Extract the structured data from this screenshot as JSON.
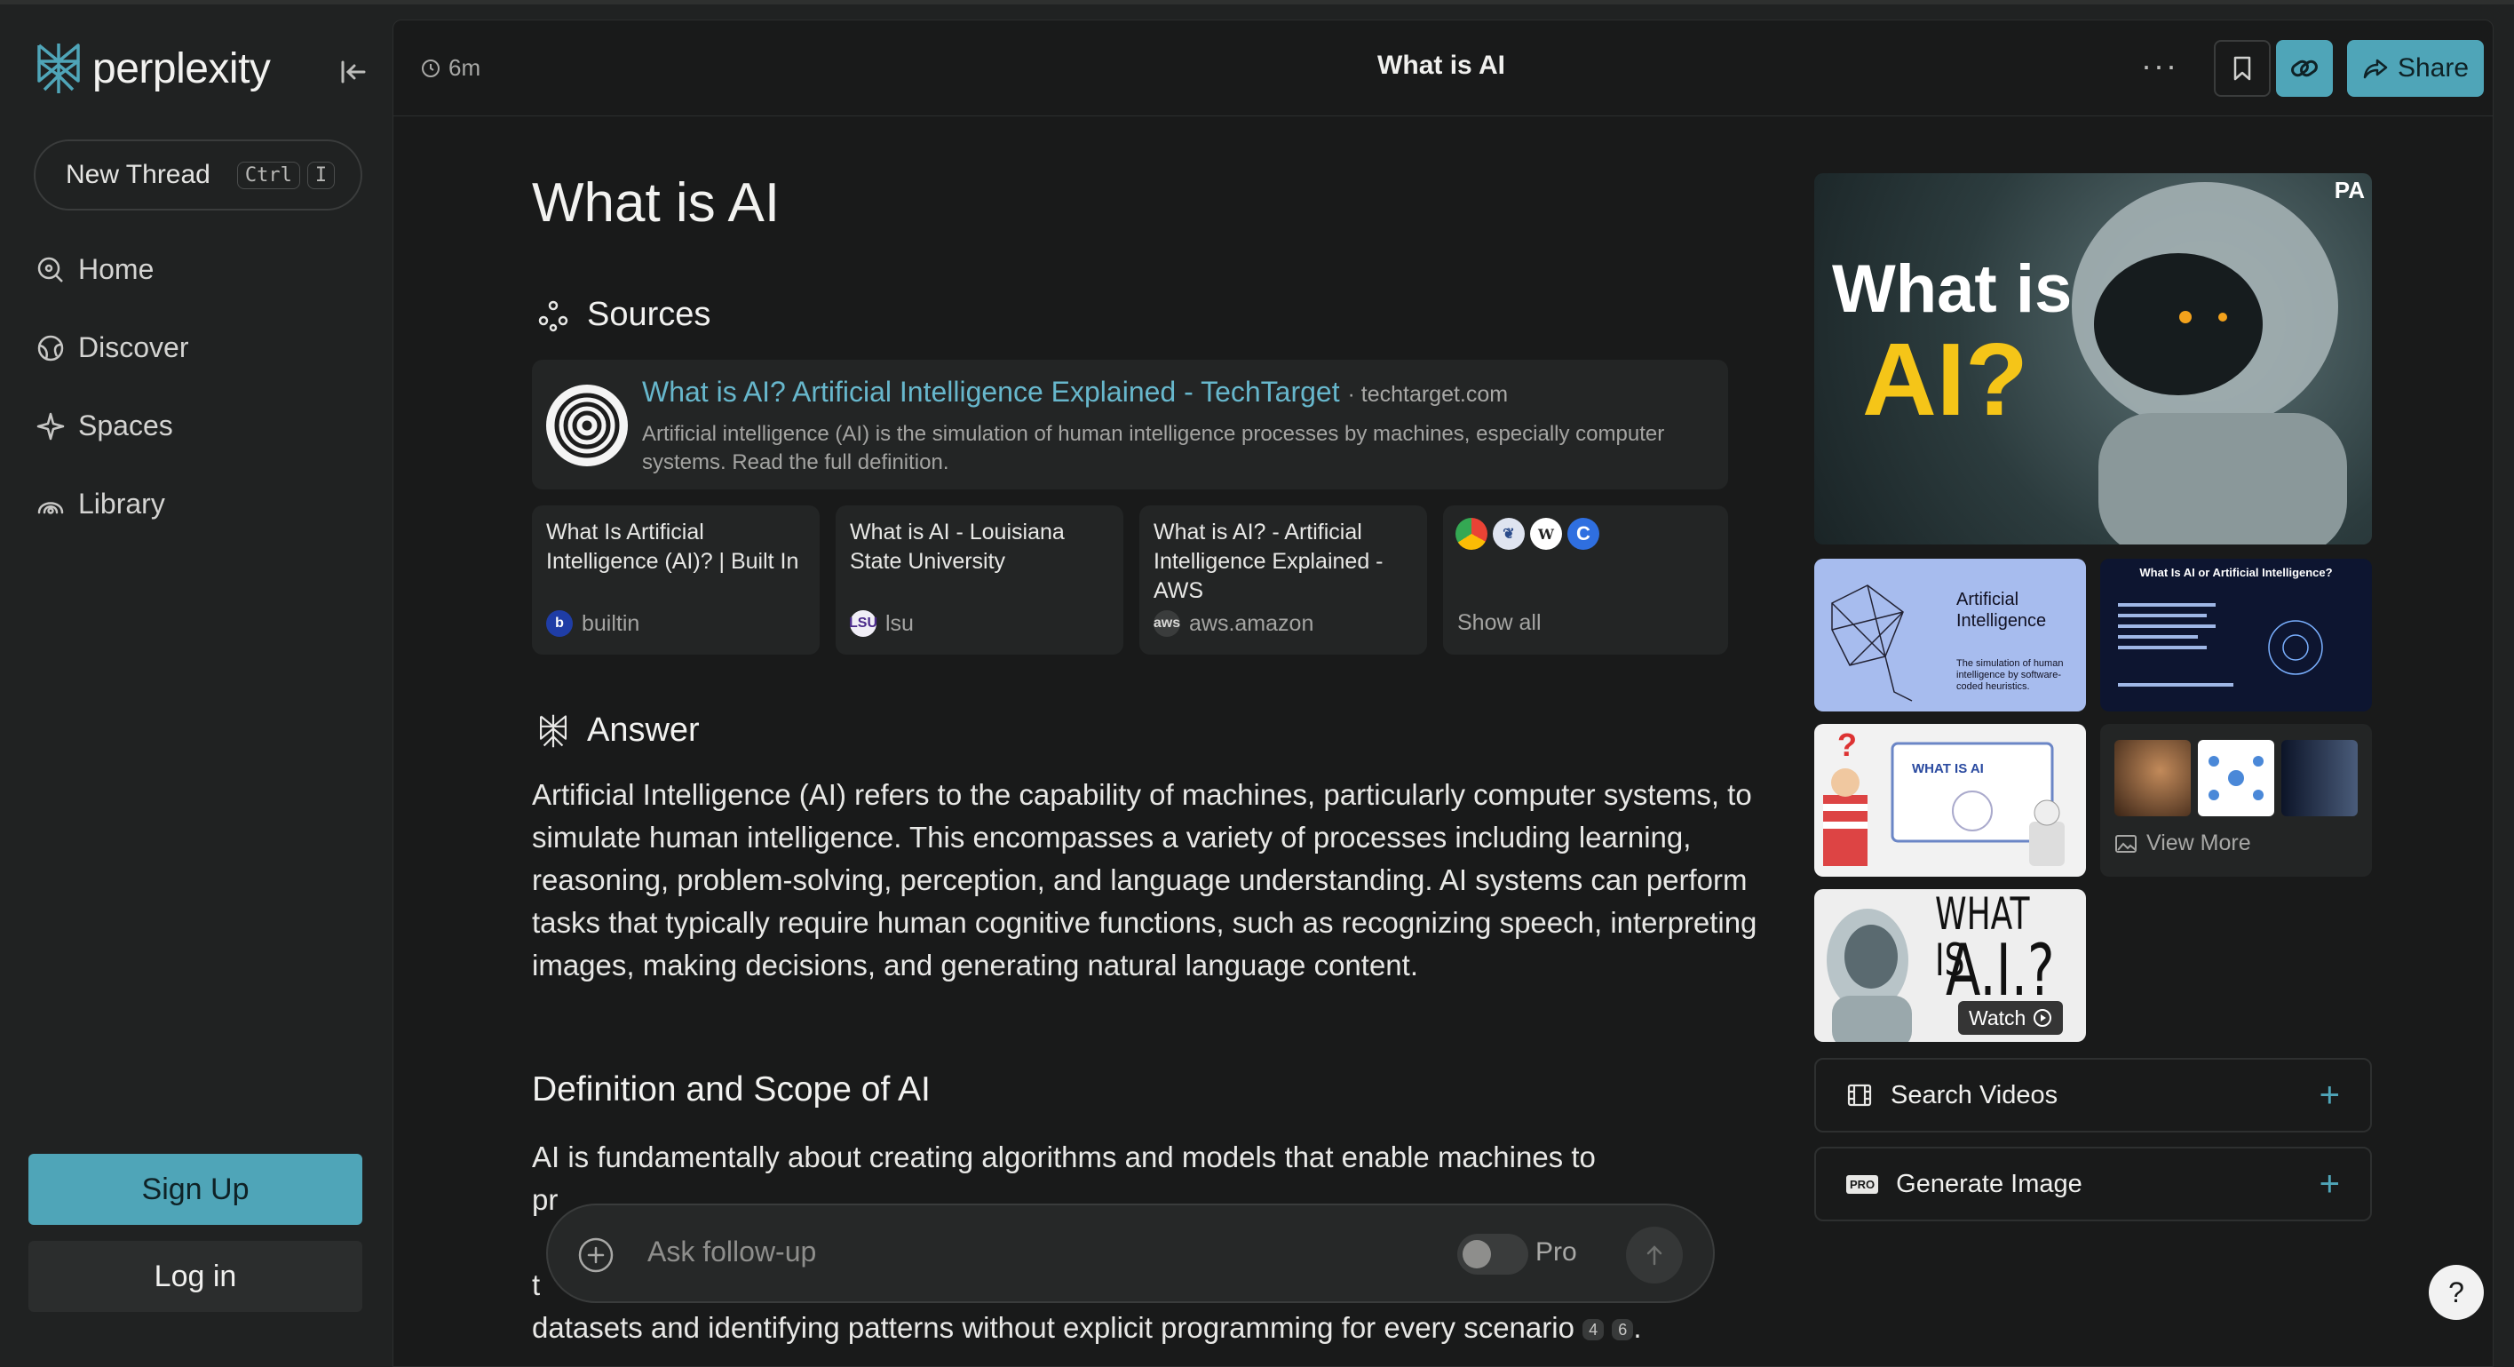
{
  "app": {
    "name": "perplexity"
  },
  "sidebar": {
    "new_thread": {
      "label": "New Thread",
      "shortcut_keys": [
        "Ctrl",
        "I"
      ]
    },
    "nav": [
      {
        "label": "Home",
        "icon": "home-search-icon"
      },
      {
        "label": "Discover",
        "icon": "globe-icon"
      },
      {
        "label": "Spaces",
        "icon": "spaces-icon"
      },
      {
        "label": "Library",
        "icon": "library-icon"
      }
    ],
    "signup_label": "Sign Up",
    "login_label": "Log in"
  },
  "header": {
    "time_ago": "6m",
    "title": "What is AI",
    "share_label": "Share"
  },
  "thread": {
    "query": "What is AI",
    "sources_heading": "Sources",
    "main_source": {
      "title": "What is AI? Artificial Intelligence Explained - TechTarget",
      "domain": "· techtarget.com",
      "description": "Artificial intelligence (AI) is the simulation of human intelligence processes by machines, especially computer systems. Read the full definition."
    },
    "source_cards": [
      {
        "title": "What Is Artificial Intelligence (AI)? | Built In",
        "domain": "builtin"
      },
      {
        "title": "What is AI - Louisiana State University",
        "domain": "lsu"
      },
      {
        "title": "What is AI? - Artificial Intelligence Explained - AWS",
        "domain": "aws.amazon"
      }
    ],
    "show_all_label": "Show all",
    "answer_heading": "Answer",
    "answer_paragraph": "Artificial Intelligence (AI) refers to the capability of machines, particularly computer systems, to simulate human intelligence. This encompasses a variety of processes including learning, reasoning, problem-solving, perception, and language understanding. AI systems can perform tasks that typically require human cognitive functions, such as recognizing speech, interpreting images, making decisions, and generating natural language content.",
    "subheading": "Definition and Scope of AI",
    "scope_line1": "AI is fundamentally about creating algorithms and models that enable machines to",
    "scope_line_last": "datasets and identifying patterns without explicit programming for every scenario",
    "citations": [
      "4",
      "6"
    ]
  },
  "followup": {
    "placeholder": "Ask follow-up",
    "pro_label": "Pro"
  },
  "media": {
    "hero_image_text": [
      "What is",
      "AI?"
    ],
    "hero_badge": "PA",
    "thumb1_text": [
      "Artificial",
      "Intelligence",
      "The simulation of human intelligence by software-coded heuristics."
    ],
    "thumb2_title": "What Is AI or Artificial Intelligence?",
    "thumb3_label": "WHAT IS AI",
    "video_text": [
      "WHAT IS",
      "A.I.?"
    ],
    "watch_label": "Watch",
    "view_more_label": "View More",
    "search_videos_label": "Search Videos",
    "generate_image_label": "Generate Image",
    "pro_badge": "PRO"
  },
  "help_label": "?",
  "colors": {
    "accent": "#4fa5b8",
    "link": "#67b7cc",
    "background": "#191a1a",
    "sidebar": "#202222"
  }
}
